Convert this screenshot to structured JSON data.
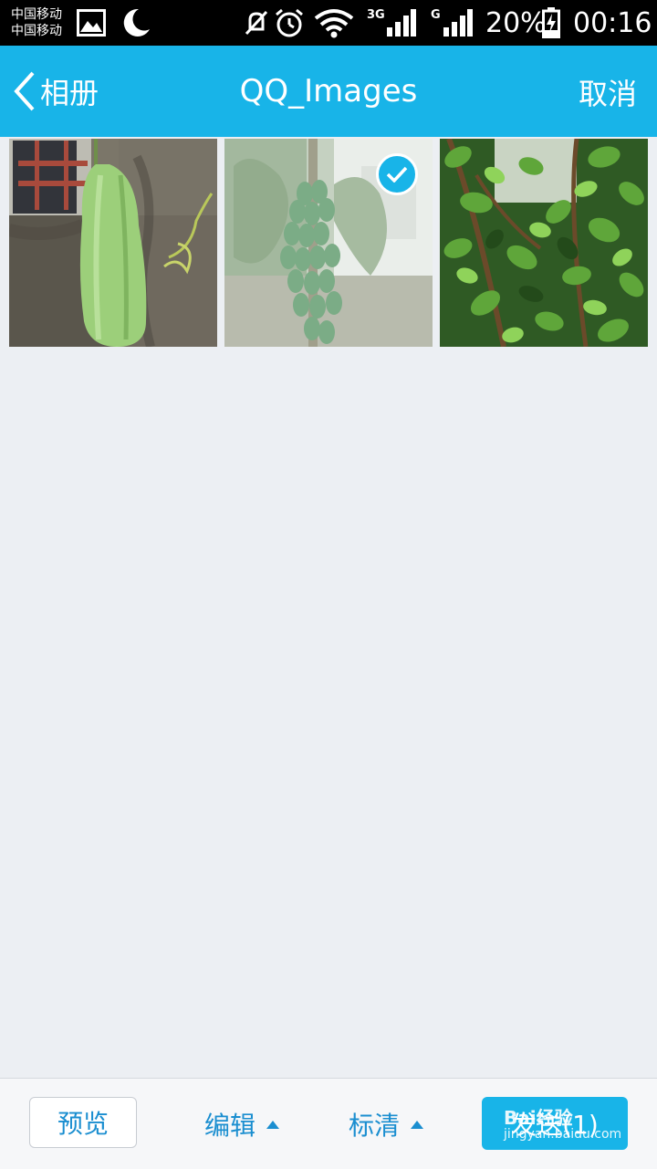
{
  "status_bar": {
    "carrier_1": "中国移动",
    "carrier_2": "中国移动",
    "network_3g": "3G",
    "network_g": "G",
    "battery": "20%",
    "time": "00:16",
    "icons": [
      "gallery-icon",
      "moon-icon",
      "mute-icon",
      "alarm-icon",
      "wifi-icon",
      "signal-3g-icon",
      "signal-g-icon",
      "battery-charging-icon"
    ]
  },
  "header": {
    "back_label": "相册",
    "title": "QQ_Images",
    "cancel_label": "取消",
    "background": "#18b4e8"
  },
  "photos": [
    {
      "subject": "luffa gourd hanging by wall",
      "selected": false
    },
    {
      "subject": "papaya tree with fruit",
      "selected": true
    },
    {
      "subject": "green leafy shrub",
      "selected": false
    }
  ],
  "bottom_bar": {
    "preview_label": "预览",
    "edit_label": "编辑",
    "quality_label": "标清",
    "send_label": "发送(1)",
    "accent": "#18b4e8"
  },
  "watermark": {
    "brand": "Bai经验",
    "url": "jingyan.baidu.com"
  }
}
